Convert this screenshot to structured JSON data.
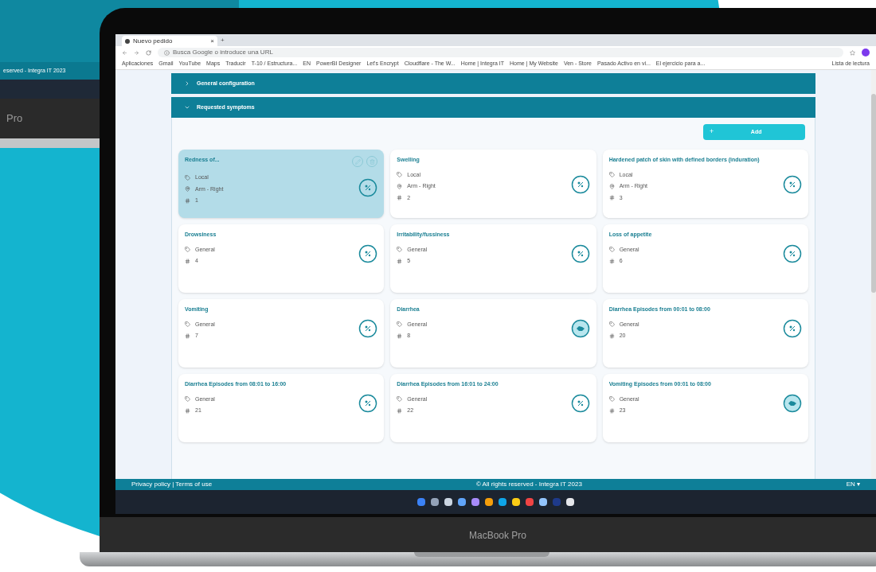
{
  "background_laptop": {
    "footer_text": "eserved - Integra IT 2023",
    "brand": "Pro"
  },
  "laptop": {
    "brand": "MacBook Pro"
  },
  "browser": {
    "tab_title": "Nuevo pedido",
    "tab_close": "×",
    "new_tab": "+",
    "address_placeholder": "Busca Google o introduce una URL",
    "bookmarks": [
      "Aplicaciones",
      "Gmail",
      "YouTube",
      "Maps",
      "Traducir",
      "T-10 / Estructura...",
      "EN",
      "PowerBI Designer",
      "Let's Encrypt",
      "Cloudflare - The W...",
      "Home | Integra IT",
      "Home | My Website",
      "Ven - Store",
      "Pasado Activo en vi...",
      "El ejercicio para a..."
    ],
    "reading_list": "Lista de lectura"
  },
  "sections": [
    {
      "title": "General configuration",
      "expanded": false
    },
    {
      "title": "Requested symptoms",
      "expanded": true
    }
  ],
  "add_button": {
    "icon": "+",
    "label": "Add"
  },
  "symptoms": [
    {
      "name": "Redness of...",
      "selected": true,
      "tags": [
        "Local",
        "Arm - Right"
      ],
      "number": "1",
      "kind": "outline"
    },
    {
      "name": "Swelling",
      "selected": false,
      "tags": [
        "Local",
        "Arm - Right"
      ],
      "number": "2",
      "kind": "outline"
    },
    {
      "name": "Hardened patch of skin with defined borders (induration)",
      "selected": false,
      "tags": [
        "Local",
        "Arm - Right"
      ],
      "number": "3",
      "kind": "outline"
    },
    {
      "name": "Drowsiness",
      "selected": false,
      "tags": [
        "General"
      ],
      "number": "4",
      "kind": "outline"
    },
    {
      "name": "Irritability/fussiness",
      "selected": false,
      "tags": [
        "General"
      ],
      "number": "5",
      "kind": "outline"
    },
    {
      "name": "Loss of appetite",
      "selected": false,
      "tags": [
        "General"
      ],
      "number": "6",
      "kind": "outline"
    },
    {
      "name": "Vomiting",
      "selected": false,
      "tags": [
        "General"
      ],
      "number": "7",
      "kind": "outline"
    },
    {
      "name": "Diarrhea",
      "selected": false,
      "tags": [
        "General"
      ],
      "number": "8",
      "kind": "filled"
    },
    {
      "name": "Diarrhea Episodes from 00:01 to 08:00",
      "selected": false,
      "tags": [
        "General"
      ],
      "number": "20",
      "kind": "outline"
    },
    {
      "name": "Diarrhea Episodes from 08:01 to 16:00",
      "selected": false,
      "tags": [
        "General"
      ],
      "number": "21",
      "kind": "outline"
    },
    {
      "name": "Diarrhea Episodes from 16:01 to 24:00",
      "selected": false,
      "tags": [
        "General"
      ],
      "number": "22",
      "kind": "outline"
    },
    {
      "name": "Vomiting Episodes from 00:01 to 08:00",
      "selected": false,
      "tags": [
        "General"
      ],
      "number": "23",
      "kind": "filled"
    }
  ],
  "footer": {
    "links": "Privacy policy | Terms of use",
    "copyright": "© All rights reserved - Integra IT 2023",
    "language": "EN ▾"
  }
}
